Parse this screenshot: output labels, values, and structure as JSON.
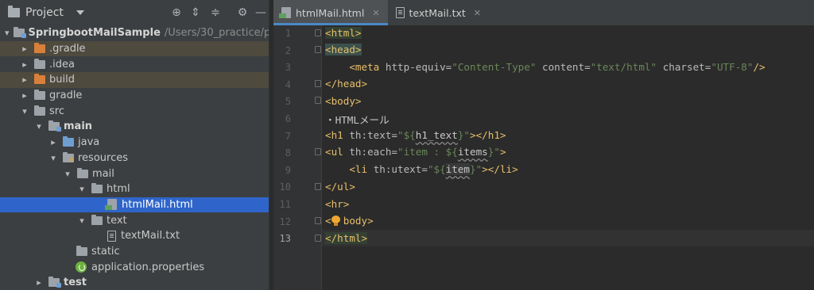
{
  "project_panel": {
    "title": "Project",
    "buttons": [
      "locate-icon",
      "expand-all-icon",
      "collapse-all-icon",
      "gear-icon",
      "minimize-icon"
    ],
    "tree": [
      {
        "label": "SpringbootMailSample",
        "path": "/Users/30_practice/pra",
        "depth": 0,
        "expanded": true,
        "icon": "module-folder-icon",
        "bold": true
      },
      {
        "label": ".gradle",
        "depth": 1,
        "expanded": false,
        "icon": "orange-folder-icon",
        "highlight": "excluded"
      },
      {
        "label": ".idea",
        "depth": 1,
        "expanded": false,
        "icon": "folder-icon"
      },
      {
        "label": "build",
        "depth": 1,
        "expanded": false,
        "icon": "orange-folder-icon",
        "highlight": "excluded"
      },
      {
        "label": "gradle",
        "depth": 1,
        "expanded": false,
        "icon": "folder-icon"
      },
      {
        "label": "src",
        "depth": 1,
        "expanded": true,
        "icon": "folder-icon"
      },
      {
        "label": "main",
        "depth": 2,
        "expanded": true,
        "icon": "module-folder-icon",
        "bold": true
      },
      {
        "label": "java",
        "depth": 3,
        "expanded": false,
        "icon": "source-folder-icon"
      },
      {
        "label": "resources",
        "depth": 3,
        "expanded": true,
        "icon": "resources-folder-icon"
      },
      {
        "label": "mail",
        "depth": 4,
        "expanded": true,
        "icon": "folder-icon"
      },
      {
        "label": "html",
        "depth": 5,
        "expanded": true,
        "icon": "folder-icon"
      },
      {
        "label": "htmlMail.html",
        "depth": 6,
        "icon": "html-file-icon",
        "selected": true
      },
      {
        "label": "text",
        "depth": 5,
        "expanded": true,
        "icon": "folder-icon"
      },
      {
        "label": "textMail.txt",
        "depth": 6,
        "icon": "text-file-icon"
      },
      {
        "label": "static",
        "depth": 4,
        "icon": "folder-icon"
      },
      {
        "label": "application.properties",
        "depth": 4,
        "icon": "spring-properties-icon"
      },
      {
        "label": "test",
        "depth": 2,
        "expanded": false,
        "icon": "module-folder-icon",
        "bold": true
      }
    ]
  },
  "tabs": [
    {
      "label": "htmlMail.html",
      "active": true,
      "icon": "html-file-icon"
    },
    {
      "label": "textMail.txt",
      "active": false,
      "icon": "text-file-icon"
    }
  ],
  "line_numbers": [
    "1",
    "2",
    "3",
    "4",
    "5",
    "6",
    "7",
    "8",
    "9",
    "10",
    "11",
    "12",
    "13"
  ],
  "current_line": 13,
  "code": {
    "l1": "<html>",
    "l2": "<head>",
    "l3_tag": "<meta",
    "l3_a1": "http-equiv=",
    "l3_v1": "\"Content-Type\"",
    "l3_a2": "content=",
    "l3_v2": "\"text/html\"",
    "l3_a3": "charset=",
    "l3_v3": "\"UTF-8\"",
    "l3_end": "/>",
    "l4": "</head>",
    "l5": "<body>",
    "l6": "・HTMLメール",
    "l7_tag": "<h1",
    "l7_attr": "th:text=",
    "l7_q1": "\"${",
    "l7_var": "h1_text",
    "l7_q2": "}\"",
    "l7_end": "></h1>",
    "l8_tag": "<ul",
    "l8_attr": "th:each=",
    "l8_q1": "\"item : ${",
    "l8_var": "items",
    "l8_q2": "}\"",
    "l8_end": ">",
    "l9_tag": "<li",
    "l9_attr": "th:utext=",
    "l9_q1": "\"${",
    "l9_var": "item",
    "l9_q2": "}\"",
    "l9_end": "></li>",
    "l10": "</ul>",
    "l11": "<hr>",
    "l12_a": "<",
    "l12_b": "body>",
    "l13": "</html>"
  },
  "colors": {
    "tag": "#e8bf6a",
    "string": "#6a8759",
    "selection": "#2f65ca",
    "excluded_row": "#4e4a3e"
  }
}
